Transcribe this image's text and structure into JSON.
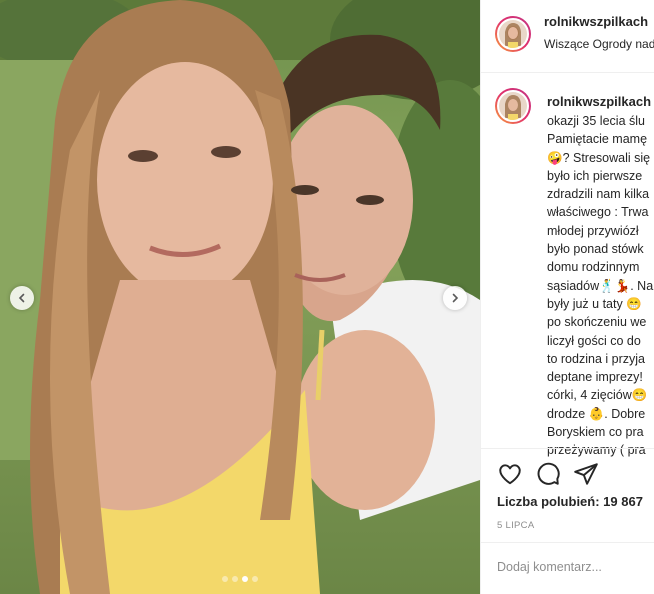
{
  "post": {
    "author": "rolnikwszpilkach",
    "location": "Wiszące Ogrody nad",
    "carousel": {
      "slide_count": 4,
      "active_slide": 3
    }
  },
  "caption": {
    "author": "rolnikwszpilkach",
    "lines": [
      "okazji 35 lecia ślu",
      "Pamiętacie mamę",
      "🤪? Stresowali się",
      "było ich pierwsze",
      "zdradzili nam kilka",
      "właściwego : Trwa",
      "młodej przywiózł",
      "było ponad stówk",
      "domu rodzinnym",
      "sąsiadów🕺💃. Na",
      "były już u taty 😁",
      "po skończeniu we",
      "liczył gości co do",
      "to rodzina i przyja",
      "deptane imprezy!",
      "córki, 4 zięciów😁",
      "drodze 👶. Dobre",
      "Boryskiem co pra",
      "przeżywamy ( pra"
    ]
  },
  "actions": {
    "like_icon": "heart-icon",
    "comment_icon": "comment-icon",
    "share_icon": "share-icon"
  },
  "likes_text": "Liczba polubień: 19 867",
  "date_text": "5 LIPCA",
  "comment": {
    "placeholder": "Dodaj komentarz..."
  },
  "colors": {
    "story_ring_start": "#f9a23a",
    "story_ring_end": "#c13584",
    "text": "#262626",
    "muted": "#8e8e8e",
    "divider": "#efefef"
  }
}
